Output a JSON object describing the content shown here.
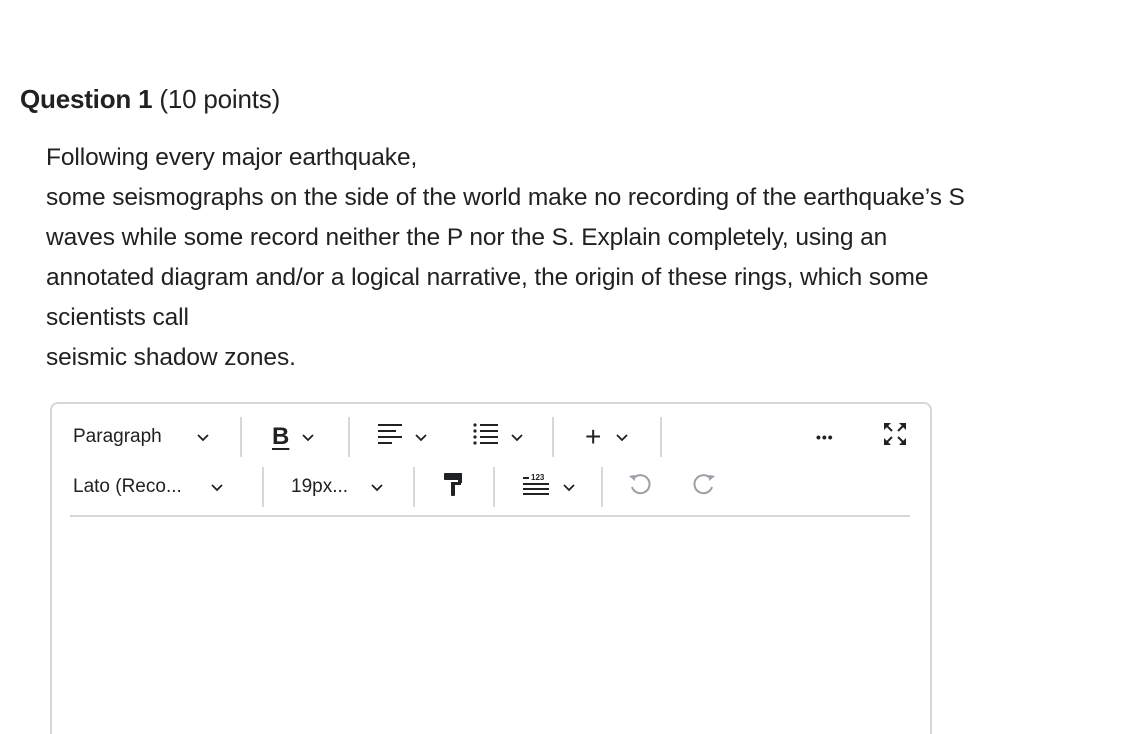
{
  "question": {
    "title": "Question 1",
    "points": "(10 points)",
    "lines": [
      "Following every major earthquake,",
      "some seismographs on the side of the world make no recording of the earthquake’s S",
      "waves while some record neither the P nor the S.  Explain completely, using an",
      "annotated diagram and/or a logical narrative, the origin of these rings, which some",
      "scientists call",
      "seismic shadow zones."
    ]
  },
  "editor": {
    "block_format": "Paragraph",
    "bold_label": "B",
    "font_family": "Lato (Reco...",
    "font_size": "19px...",
    "insert_label": "+",
    "numbered_label": "123",
    "more_label": "•••",
    "icons": {
      "align": "align-icon",
      "list": "list-icon",
      "insert": "plus-icon",
      "paint": "format-painter-icon",
      "numbered": "line-height-icon",
      "undo": "undo-icon",
      "redo": "redo-icon",
      "more": "more-icon",
      "fullscreen": "fullscreen-icon"
    },
    "content": ""
  }
}
